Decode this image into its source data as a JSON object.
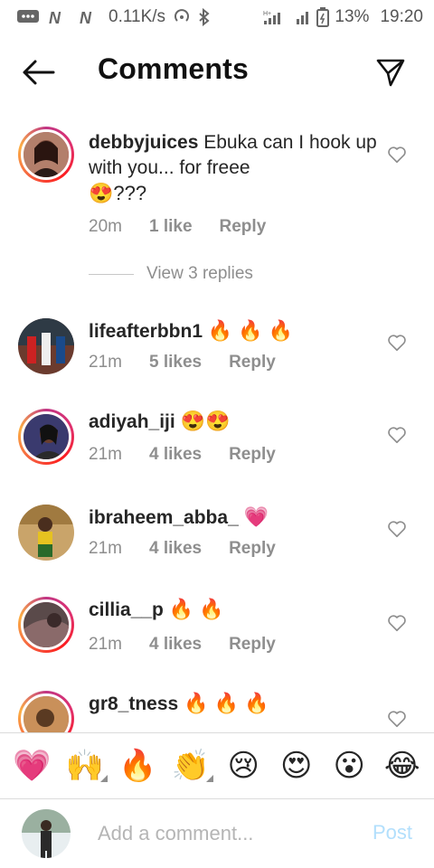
{
  "status_bar": {
    "speed": "0.11K/s",
    "battery": "13%",
    "time": "19:20"
  },
  "header": {
    "title": "Comments"
  },
  "comments": [
    {
      "username": "debbyjuices",
      "text": "Ebuka can I hook up with you... for freee",
      "emoji": "😍???",
      "time": "20m",
      "likes": "1 like",
      "reply": "Reply",
      "view_replies": "View 3 replies"
    },
    {
      "username": "lifeafterbbn1",
      "text": "",
      "emoji": "🔥 🔥 🔥",
      "time": "21m",
      "likes": "5 likes",
      "reply": "Reply"
    },
    {
      "username": "adiyah_iji",
      "text": "",
      "emoji": "😍😍",
      "time": "21m",
      "likes": "4 likes",
      "reply": "Reply"
    },
    {
      "username": "ibraheem_abba_",
      "text": "",
      "emoji": "💗",
      "time": "21m",
      "likes": "4 likes",
      "reply": "Reply"
    },
    {
      "username": "cillia__p",
      "text": "",
      "emoji": "🔥 🔥",
      "time": "21m",
      "likes": "4 likes",
      "reply": "Reply"
    },
    {
      "username": "gr8_tness",
      "text": "",
      "emoji": "🔥 🔥 🔥"
    }
  ],
  "emoji_tray": {
    "items": [
      "💗",
      "🙌",
      "🔥",
      "👏",
      "😢",
      "😍",
      "😮",
      "😂"
    ]
  },
  "composer": {
    "placeholder": "Add a comment...",
    "post_label": "Post"
  },
  "colors": {
    "link_disabled": "#b2dffc",
    "muted": "#8e8e8e",
    "ring_start": "#c13584",
    "ring_end": "#fcaf45"
  }
}
